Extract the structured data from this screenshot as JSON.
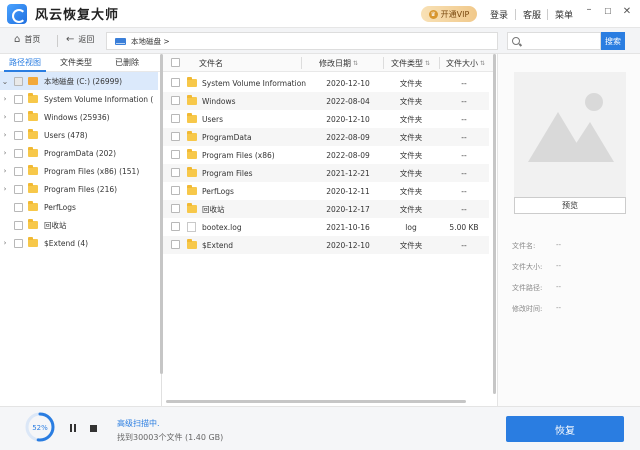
{
  "app": {
    "title": "风云恢复大师",
    "vip_label": "开通VIP",
    "vip_icon": "crown-icon",
    "links": {
      "login": "登录",
      "service": "客服",
      "menu": "菜单"
    }
  },
  "toolbar": {
    "home_label": "首页",
    "back_label": "返回",
    "path": "本地磁盘 >",
    "search_placeholder": "",
    "search_button": "搜索"
  },
  "left_tabs": [
    "路径视图",
    "文件类型",
    "已删除"
  ],
  "tree": [
    {
      "label": "本地磁盘 (C:) (26999)",
      "has_arrow": true,
      "kind": "drive",
      "selected": true
    },
    {
      "label": "System Volume Information (",
      "has_arrow": true,
      "kind": "folder"
    },
    {
      "label": "Windows (25936)",
      "has_arrow": true,
      "kind": "folder"
    },
    {
      "label": "Users (478)",
      "has_arrow": true,
      "kind": "folder"
    },
    {
      "label": "ProgramData (202)",
      "has_arrow": true,
      "kind": "folder"
    },
    {
      "label": "Program Files (x86) (151)",
      "has_arrow": true,
      "kind": "folder"
    },
    {
      "label": "Program Files (216)",
      "has_arrow": true,
      "kind": "folder"
    },
    {
      "label": "PerfLogs",
      "has_arrow": false,
      "kind": "folder"
    },
    {
      "label": "回收站",
      "has_arrow": false,
      "kind": "folder"
    },
    {
      "label": "$Extend (4)",
      "has_arrow": true,
      "kind": "folder"
    }
  ],
  "table": {
    "columns": {
      "name": "文件名",
      "date": "修改日期",
      "type": "文件类型",
      "size": "文件大小"
    },
    "rows": [
      {
        "name": "System Volume Information",
        "date": "2020-12-10",
        "type": "文件夹",
        "size": "--",
        "icon": "folder"
      },
      {
        "name": "Windows",
        "date": "2022-08-04",
        "type": "文件夹",
        "size": "--",
        "icon": "folder"
      },
      {
        "name": "Users",
        "date": "2020-12-10",
        "type": "文件夹",
        "size": "--",
        "icon": "folder"
      },
      {
        "name": "ProgramData",
        "date": "2022-08-09",
        "type": "文件夹",
        "size": "--",
        "icon": "folder"
      },
      {
        "name": "Program Files (x86)",
        "date": "2022-08-09",
        "type": "文件夹",
        "size": "--",
        "icon": "folder"
      },
      {
        "name": "Program Files",
        "date": "2021-12-21",
        "type": "文件夹",
        "size": "--",
        "icon": "folder"
      },
      {
        "name": "PerfLogs",
        "date": "2020-12-11",
        "type": "文件夹",
        "size": "--",
        "icon": "folder"
      },
      {
        "name": "回收站",
        "date": "2020-12-17",
        "type": "文件夹",
        "size": "--",
        "icon": "folder"
      },
      {
        "name": "bootex.log",
        "date": "2021-10-16",
        "type": "log",
        "size": "5.00  KB",
        "icon": "file"
      },
      {
        "name": "$Extend",
        "date": "2020-12-10",
        "type": "文件夹",
        "size": "--",
        "icon": "folder"
      }
    ]
  },
  "preview": {
    "button": "预览",
    "info": [
      {
        "label": "文件名:",
        "value": "--"
      },
      {
        "label": "文件大小:",
        "value": "--"
      },
      {
        "label": "文件路径:",
        "value": "--"
      },
      {
        "label": "修改时间:",
        "value": "--"
      }
    ]
  },
  "scan": {
    "progress_text": "52%",
    "progress_value": 0.52,
    "status": "高级扫描中.",
    "found": "找到30003个文件 (1.40 GB)"
  },
  "recover_button": "恢复",
  "colors": {
    "accent": "#2a7de1",
    "folder": "#f7c84a",
    "vip": "#f1c98b"
  }
}
